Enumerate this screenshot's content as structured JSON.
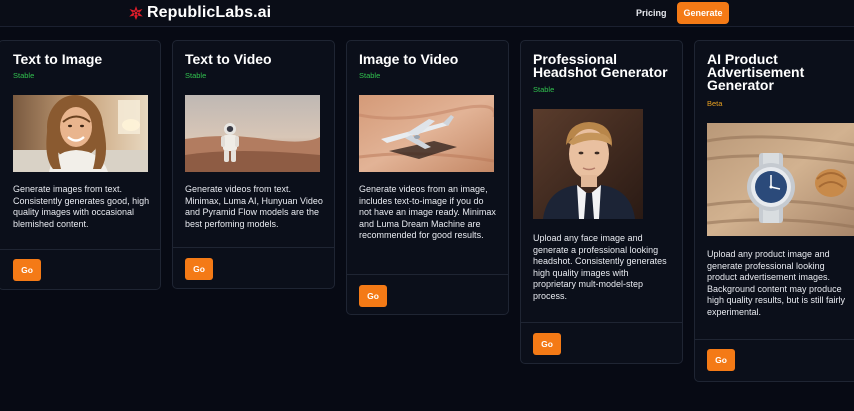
{
  "header": {
    "logo_text": "RepublicLabs.ai",
    "logo_icon": "starburst-logo-icon",
    "nav_pricing": "Pricing",
    "nav_generate": "Generate"
  },
  "colors": {
    "accent": "#f47a16",
    "stable": "#31c24f",
    "beta": "#e8a020",
    "background": "#070a14",
    "card": "#0b0f1a"
  },
  "cards": [
    {
      "title": "Text to Image",
      "status": "Stable",
      "image": "smiling-woman-photo",
      "description": "Generate images from text. Consistently generates good, high quality images with occasional blemished content.",
      "button": "Go"
    },
    {
      "title": "Text to Video",
      "status": "Stable",
      "image": "astronaut-desert-photo",
      "description": "Generate videos from text. Minimax, Luma AI, Hunyuan Video and Pyramid Flow models are the best perfoming models.",
      "button": "Go"
    },
    {
      "title": "Image to Video",
      "status": "Stable",
      "image": "airplane-desert-photo",
      "description": "Generate videos from an image, includes text-to-image if you do not have an image ready. Minimax and Luma Dream Machine are recommended for good results.",
      "button": "Go"
    },
    {
      "title": "Professional Headshot Generator",
      "status": "Stable",
      "image": "professional-headshot-photo",
      "description": "Upload any face image and generate a professional looking headshot. Consistently generates high quality images with proprietary mult-model-step process.",
      "button": "Go"
    },
    {
      "title": "AI Product Advertisement Generator",
      "status": "Beta",
      "image": "watch-on-sand-photo",
      "description": "Upload any product image and generate professional looking product advertisement images. Background content may produce high quality results, but is still fairly experimental.",
      "button": "Go"
    }
  ]
}
